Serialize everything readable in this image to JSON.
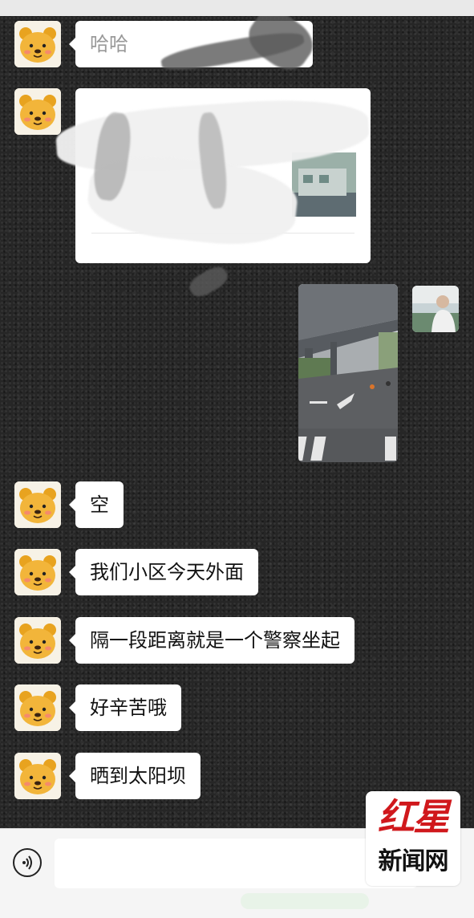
{
  "messages": [
    {
      "text": "哈哈",
      "type": "text",
      "redacted": true
    },
    {
      "text": "",
      "type": "link-card",
      "redacted": true
    },
    {
      "type": "image",
      "from": "self"
    },
    {
      "text": "空",
      "type": "text"
    },
    {
      "text": "我们小区今天外面",
      "type": "text"
    },
    {
      "text": "隔一段距离就是一个警察坐起",
      "type": "text"
    },
    {
      "text": "好辛苦哦",
      "type": "text"
    },
    {
      "text": "晒到太阳坝",
      "type": "text"
    }
  ],
  "avatar_icon": "winnie-the-pooh-avatar",
  "input": {
    "value": "",
    "placeholder": ""
  },
  "watermark": {
    "brand": "红星",
    "sub": "新闻网"
  },
  "colors": {
    "bubble": "#ffffff",
    "chat_bg": "#262626",
    "brand_red": "#d0181c"
  }
}
